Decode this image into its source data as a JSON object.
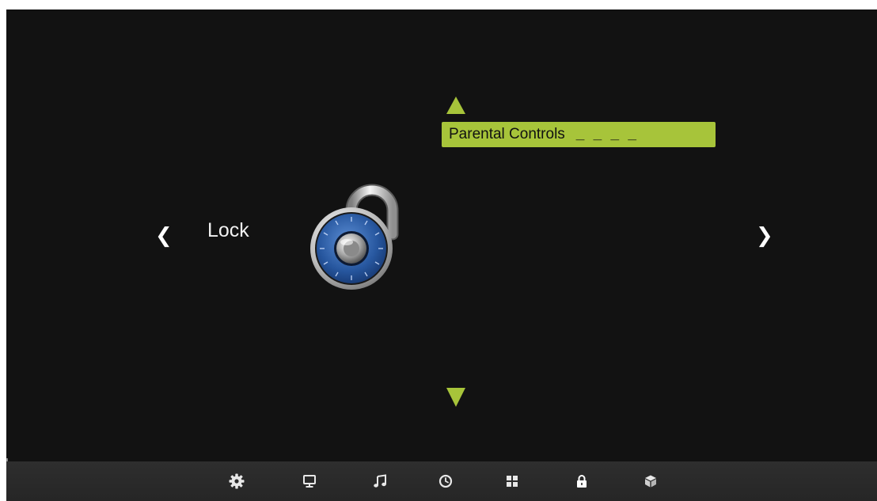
{
  "colors": {
    "accent": "#a7c43a",
    "screen_bg": "#121212",
    "bar_bg": "#2a2a2a",
    "text": "#ffffff"
  },
  "category": {
    "label": "Lock",
    "prev_arrow": "❮",
    "next_arrow": "❯",
    "icon": "padlock-icon"
  },
  "menu": {
    "items": [
      {
        "label": "Parental Controls",
        "value": "_ _ _ _",
        "selected": true
      }
    ],
    "scroll_up_icon": "triangle-up-icon",
    "scroll_down_icon": "triangle-down-icon"
  },
  "bottom_bar": {
    "icons": [
      {
        "name": "settings-gear-icon",
        "active": false
      },
      {
        "name": "display-monitor-icon",
        "active": false
      },
      {
        "name": "music-note-icon",
        "active": false
      },
      {
        "name": "clock-icon",
        "active": false
      },
      {
        "name": "apps-grid-icon",
        "active": false
      },
      {
        "name": "lock-icon",
        "active": true
      },
      {
        "name": "cube-icon",
        "active": false
      }
    ]
  }
}
